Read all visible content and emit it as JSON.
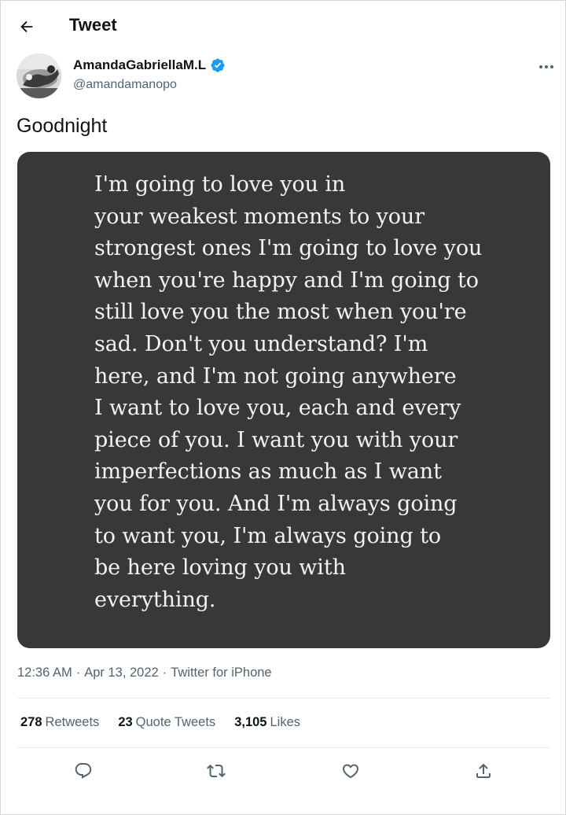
{
  "header": {
    "title": "Tweet",
    "back_icon": "arrow-left-icon"
  },
  "author": {
    "display_name": "AmandaGabriellaM.L",
    "handle": "@amandamanopo",
    "verified": true,
    "verified_color": "#1d9bf0",
    "more_icon": "ellipsis-icon"
  },
  "tweet": {
    "text": "Goodnight",
    "image_text_lines": [
      "I'm going to love you in",
      "your weakest moments to your",
      "strongest ones I'm going to love you",
      "when you're happy and I'm going to",
      "still love you the most when you're",
      "sad. Don't you understand? I'm",
      "here, and I'm not going anywhere",
      "I want to love you, each and every",
      "piece of you. I want you with your",
      "imperfections as much as I want",
      "you for you. And I'm always going",
      "to want you, I'm always going to",
      "be here loving you with",
      "everything."
    ],
    "time": "12:36 AM",
    "date": "Apr 13, 2022",
    "source": "Twitter for iPhone",
    "separator": "·"
  },
  "stats": {
    "retweets_count": "278",
    "retweets_label": "Retweets",
    "quotes_count": "23",
    "quotes_label": "Quote Tweets",
    "likes_count": "3,105",
    "likes_label": "Likes"
  },
  "actions": [
    "reply-icon",
    "retweet-icon",
    "like-icon",
    "share-icon"
  ],
  "colors": {
    "text_primary": "#0f1419",
    "text_secondary": "#536471",
    "media_bg": "#383838",
    "divider": "#e6ecf0"
  }
}
